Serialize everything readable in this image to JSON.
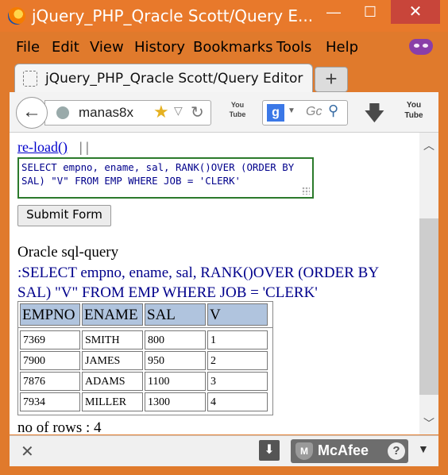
{
  "window": {
    "title": "jQuery_PHP_Qracle Scott/Query E...",
    "minimize": "—",
    "maximize": "☐",
    "close": "✕"
  },
  "menu": [
    "File",
    "Edit",
    "View",
    "History",
    "Bookmarks",
    "Tools",
    "Help"
  ],
  "tab": {
    "title": "jQuery_PHP_Qracle Scott/Query Editor",
    "new_tab": "+"
  },
  "navbar": {
    "back": "←",
    "url": "manas8x",
    "star": "★",
    "dropdown": "▽",
    "reload": "↻",
    "youtube1": "You Tube",
    "search_engine": "g",
    "search_placeholder": "Gc",
    "youtube2": "You Tube"
  },
  "page": {
    "reload_link": "re-load()",
    "separator": "| |",
    "query": "SELECT empno, ename, sal, RANK()OVER (ORDER BY SAL) \"V\" FROM EMP WHERE JOB = 'CLERK'",
    "submit_label": "Submit Form",
    "result_heading": "Oracle sql-query",
    "result_query": ":SELECT empno, ename, sal, RANK()OVER (ORDER BY SAL) \"V\" FROM EMP WHERE JOB = 'CLERK'",
    "table": {
      "headers": [
        "EMPNO",
        "ENAME",
        "SAL",
        "V"
      ],
      "rows": [
        [
          "7369",
          "SMITH",
          "800",
          "1"
        ],
        [
          "7900",
          "JAMES",
          "950",
          "2"
        ],
        [
          "7876",
          "ADAMS",
          "1100",
          "3"
        ],
        [
          "7934",
          "MILLER",
          "1300",
          "4"
        ]
      ]
    },
    "row_count": "no of rows : 4"
  },
  "addon_bar": {
    "close": "✕",
    "mcafee": "McAfee",
    "help": "?"
  },
  "colors": {
    "titlebar": "#e8792b",
    "query_border": "#2b7a2b",
    "query_text": "#00008b",
    "table_header": "#b0c4de",
    "link": "#0000cc"
  }
}
